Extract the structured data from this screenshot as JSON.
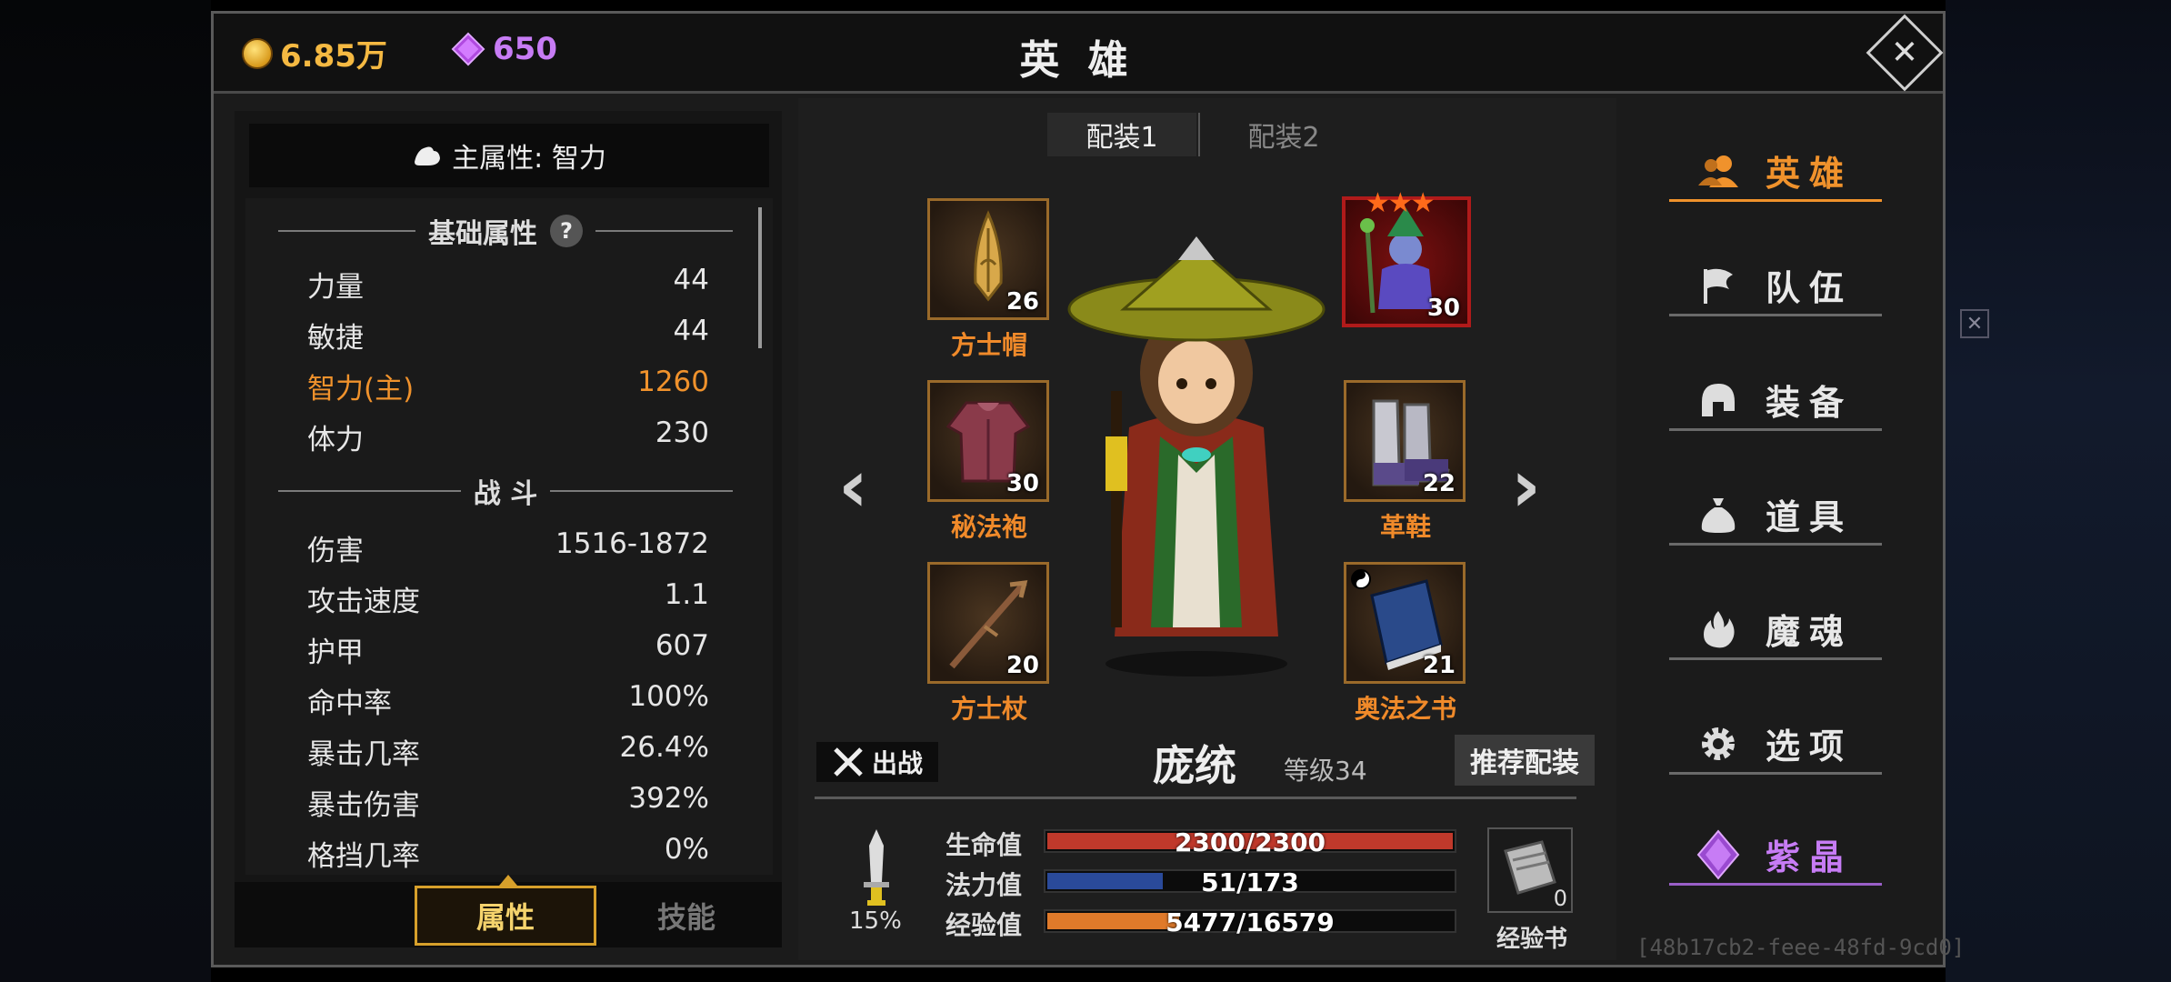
{
  "currency": {
    "gold": "6.85万",
    "gems": "650"
  },
  "title": "英 雄",
  "main_attribute": "主属性: 智力",
  "stats": {
    "basic_header": "基础属性",
    "basic": [
      {
        "label": "力量",
        "value": "44"
      },
      {
        "label": "敏捷",
        "value": "44"
      },
      {
        "label": "智力(主)",
        "value": "1260"
      },
      {
        "label": "体力",
        "value": "230"
      }
    ],
    "combat_header": "战 斗",
    "combat": [
      {
        "label": "伤害",
        "value": "1516-1872"
      },
      {
        "label": "攻击速度",
        "value": "1.1"
      },
      {
        "label": "护甲",
        "value": "607"
      },
      {
        "label": "命中率",
        "value": "100%"
      },
      {
        "label": "暴击几率",
        "value": "26.4%"
      },
      {
        "label": "暴击伤害",
        "value": "392%"
      },
      {
        "label": "格挡几率",
        "value": "0%"
      }
    ]
  },
  "bottom_tabs": {
    "attributes": "属性",
    "skills": "技能"
  },
  "loadouts": [
    "配装1",
    "配装2"
  ],
  "equipment": {
    "hat": {
      "label": "方士帽",
      "level": "26"
    },
    "robe": {
      "label": "秘法袍",
      "level": "30"
    },
    "staff": {
      "label": "方士杖",
      "level": "20"
    },
    "companion": {
      "level": "30",
      "stars": 3
    },
    "boots": {
      "label": "革鞋",
      "level": "22"
    },
    "book": {
      "label": "奥法之书",
      "level": "21"
    }
  },
  "hero": {
    "name": "庞统",
    "level": "等级34",
    "deploy": "出战",
    "recommend": "推荐配装"
  },
  "bars": {
    "hp": {
      "label": "生命值",
      "text": "2300/2300",
      "fraction": 1.0,
      "color": "#c0392b"
    },
    "mp": {
      "label": "法力值",
      "text": "51/173",
      "fraction": 0.29,
      "color": "#2a4a9a"
    },
    "xp": {
      "label": "经验值",
      "text": "5477/16579",
      "fraction": 0.33,
      "color": "#e07a2a"
    }
  },
  "weapon_percent": "15%",
  "exp_book": {
    "label": "经验书",
    "count": "0"
  },
  "nav": [
    {
      "label": "英雄",
      "icon": "hero-icon"
    },
    {
      "label": "队伍",
      "icon": "flag-icon"
    },
    {
      "label": "装备",
      "icon": "helmet-icon"
    },
    {
      "label": "道具",
      "icon": "bag-icon"
    },
    {
      "label": "魔魂",
      "icon": "flame-icon"
    },
    {
      "label": "选项",
      "icon": "gear-icon"
    },
    {
      "label": "紫晶",
      "icon": "gem-icon"
    }
  ],
  "uuid": "[48b17cb2-feee-48fd-9cd0]"
}
